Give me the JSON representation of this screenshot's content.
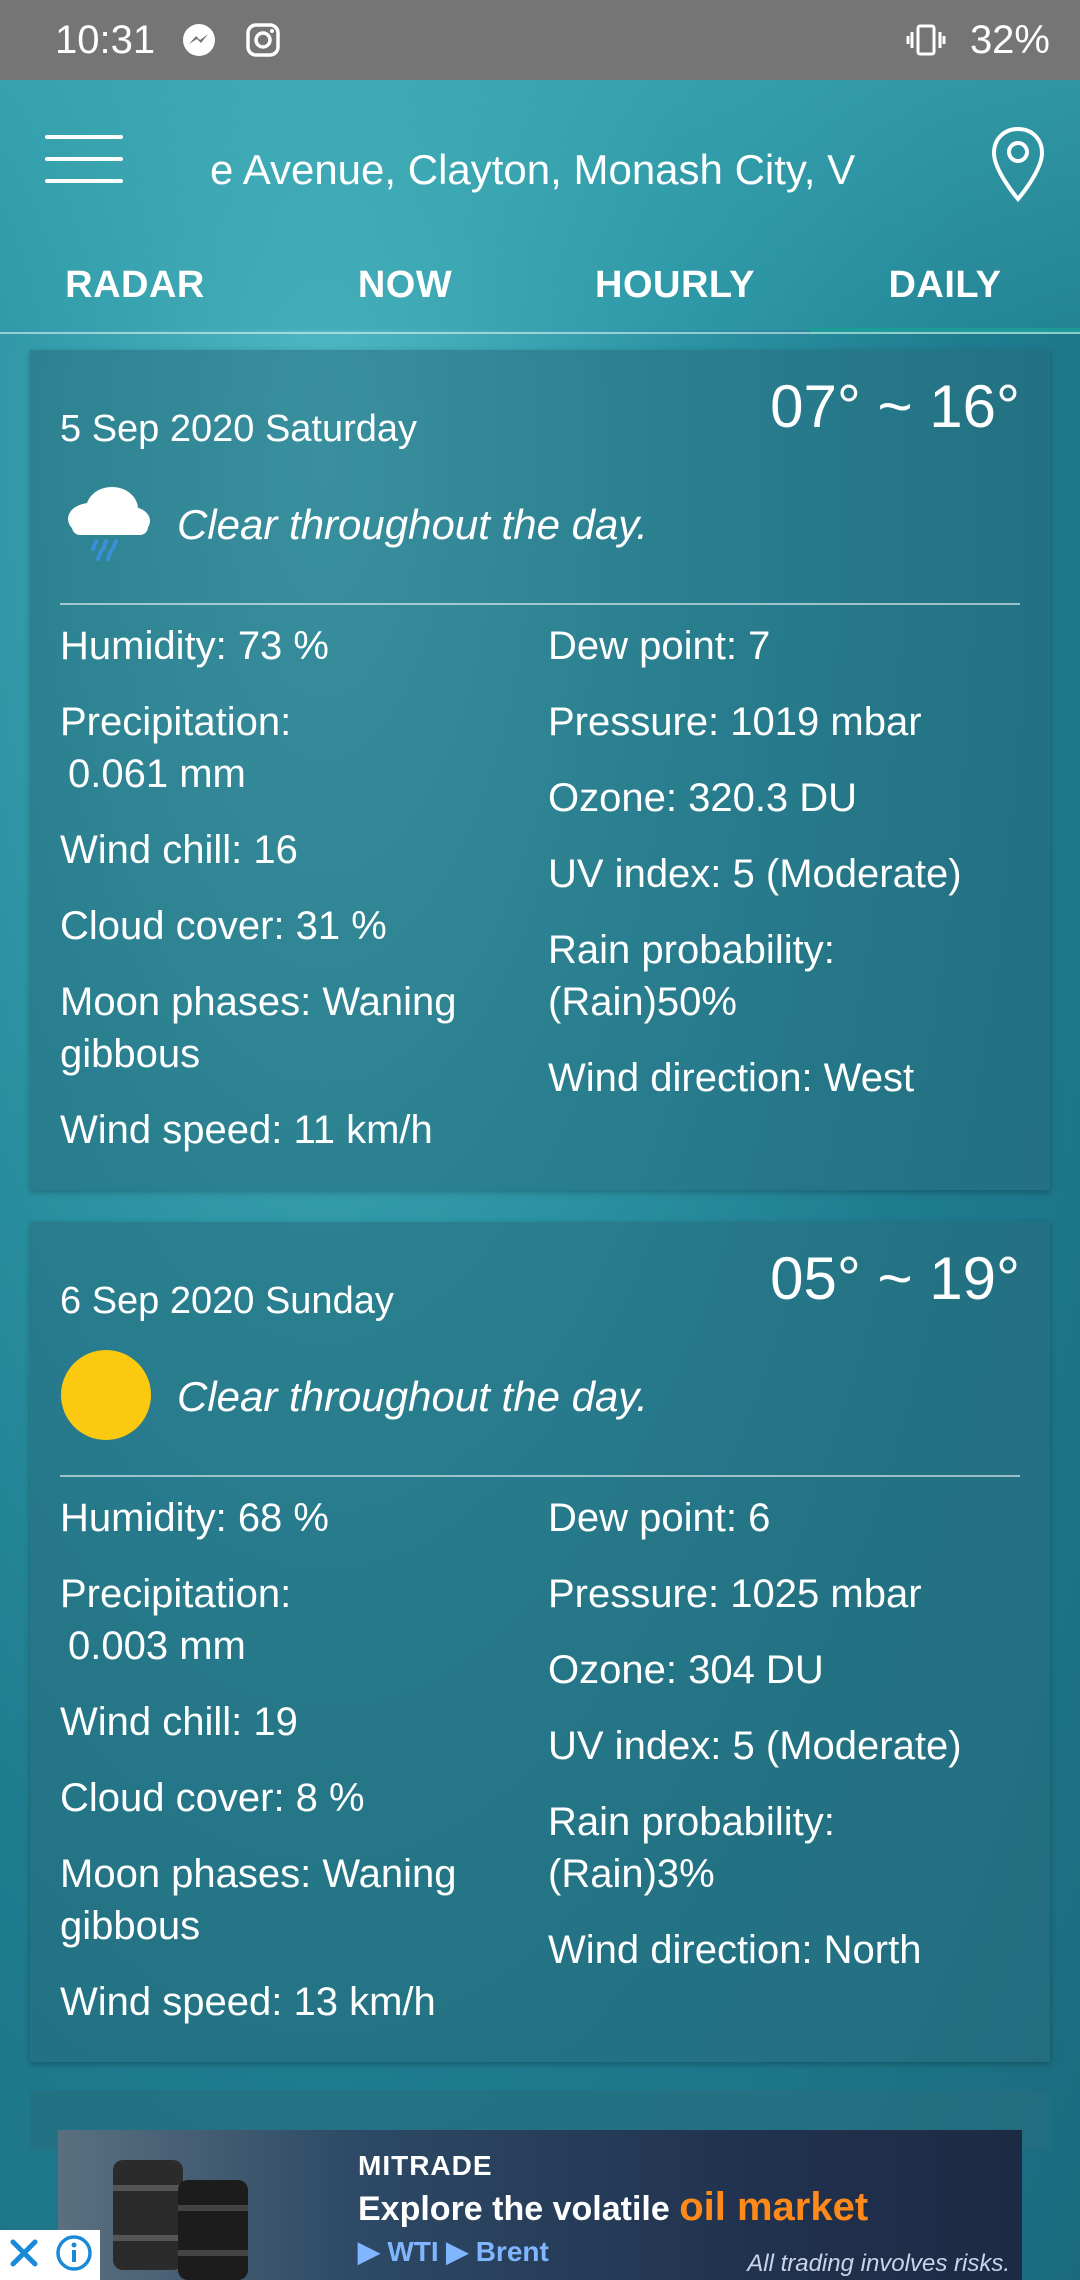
{
  "status_bar": {
    "time": "10:31",
    "battery": "32%",
    "icons": [
      "messenger-icon",
      "instagram-icon",
      "vibrate-icon"
    ]
  },
  "header": {
    "location": "e Avenue, Clayton, Monash City, V",
    "tabs": [
      {
        "label": "RADAR",
        "active": false
      },
      {
        "label": "NOW",
        "active": false
      },
      {
        "label": "HOURLY",
        "active": false
      },
      {
        "label": "DAILY",
        "active": true
      }
    ]
  },
  "days": [
    {
      "date": "5 Sep 2020 Saturday",
      "temp_range": "07° ~ 16°",
      "condition": "Clear throughout the day.",
      "icon": "cloud-rain-icon",
      "left": {
        "humidity": "Humidity: 73 %",
        "precip_label": "Precipitation:",
        "precip_value": "0.061 mm",
        "wind_chill": "Wind chill: 16",
        "cloud_cover": "Cloud cover: 31 %",
        "moon_phase": "Moon phases: Waning gibbous",
        "wind_speed": "Wind speed: 11 km/h"
      },
      "right": {
        "dew_point": "Dew point: 7",
        "pressure": "Pressure: 1019 mbar",
        "ozone": "Ozone: 320.3 DU",
        "uv_index": "UV index: 5 (Moderate)",
        "rain_prob_label": "Rain probability:",
        "rain_prob_value": "(Rain)50%",
        "wind_direction": "Wind direction: West"
      }
    },
    {
      "date": "6 Sep 2020 Sunday",
      "temp_range": "05° ~ 19°",
      "condition": "Clear throughout the day.",
      "icon": "sun-icon",
      "left": {
        "humidity": "Humidity: 68 %",
        "precip_label": "Precipitation:",
        "precip_value": "0.003 mm",
        "wind_chill": "Wind chill: 19",
        "cloud_cover": "Cloud cover: 8 %",
        "moon_phase": "Moon phases: Waning gibbous",
        "wind_speed": "Wind speed: 13 km/h"
      },
      "right": {
        "dew_point": "Dew point: 6",
        "pressure": "Pressure: 1025 mbar",
        "ozone": "Ozone: 304 DU",
        "uv_index": "UV index: 5 (Moderate)",
        "rain_prob_label": "Rain probability:",
        "rain_prob_value": "(Rain)3%",
        "wind_direction": "Wind direction: North"
      }
    }
  ],
  "ad": {
    "brand": "MITRADE",
    "headline_pre": "Explore the volatile ",
    "headline_accent": "oil market",
    "links": "▶ WTI   ▶ Brent",
    "disclaimer": "All trading involves risks.",
    "accent_color": "#ff8a1a"
  }
}
